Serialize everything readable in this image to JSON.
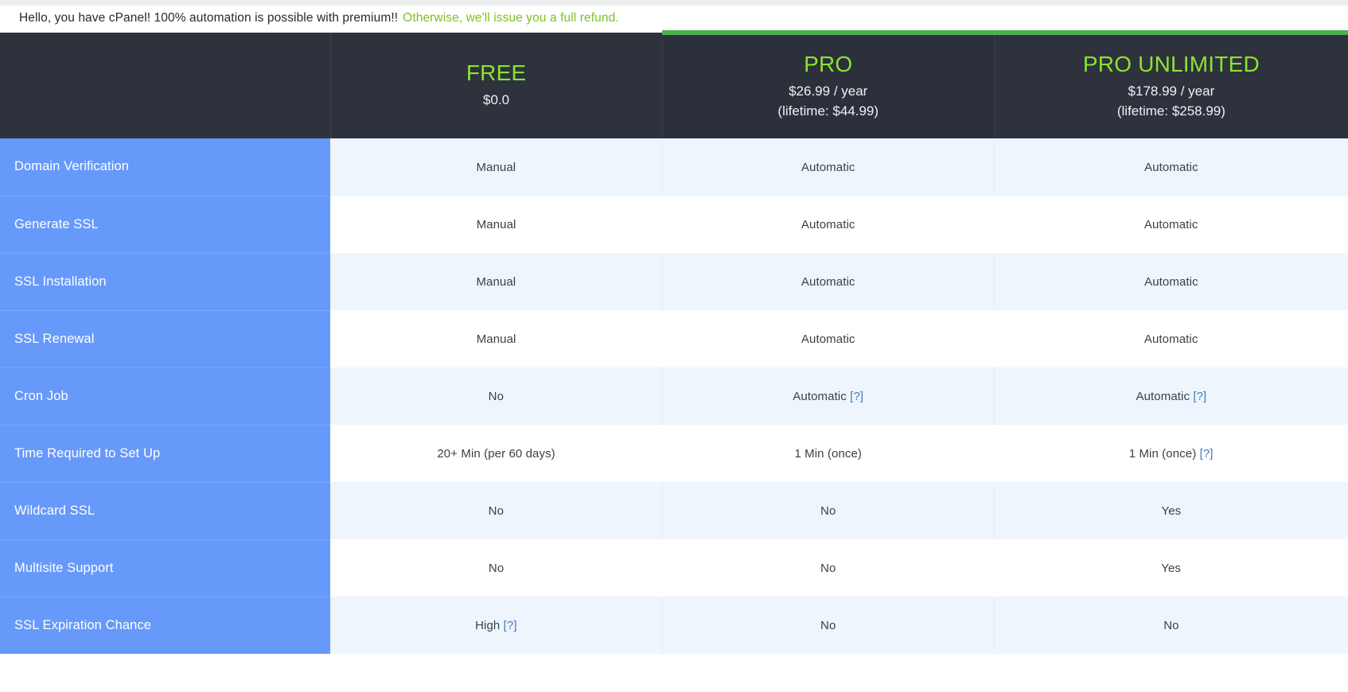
{
  "banner": {
    "message": "Hello, you have cPanel! 100% automation is possible with premium!!",
    "refund_link": "Otherwise, we'll issue you a full refund."
  },
  "table": {
    "feature_column_header": "",
    "plans": [
      {
        "name": "FREE",
        "price": "$0.0",
        "lifetime": "",
        "highlighted": false
      },
      {
        "name": "PRO",
        "price": "$26.99 / year",
        "lifetime": "(lifetime: $44.99)",
        "highlighted": true
      },
      {
        "name": "PRO UNLIMITED",
        "price": "$178.99 / year",
        "lifetime": "(lifetime: $258.99)",
        "highlighted": false
      }
    ],
    "rows": [
      {
        "feature": "Domain Verification",
        "free": "Manual",
        "free_hint": "",
        "pro": "Automatic",
        "pro_hint": "",
        "pro_unlimited": "Automatic",
        "pro_unlimited_hint": ""
      },
      {
        "feature": "Generate SSL",
        "free": "Manual",
        "free_hint": "",
        "pro": "Automatic",
        "pro_hint": "",
        "pro_unlimited": "Automatic",
        "pro_unlimited_hint": ""
      },
      {
        "feature": "SSL Installation",
        "free": "Manual",
        "free_hint": "",
        "pro": "Automatic",
        "pro_hint": "",
        "pro_unlimited": "Automatic",
        "pro_unlimited_hint": ""
      },
      {
        "feature": "SSL Renewal",
        "free": "Manual",
        "free_hint": "",
        "pro": "Automatic",
        "pro_hint": "",
        "pro_unlimited": "Automatic",
        "pro_unlimited_hint": ""
      },
      {
        "feature": "Cron Job",
        "free": "No",
        "free_hint": "",
        "pro": "Automatic ",
        "pro_hint": "[?]",
        "pro_unlimited": "Automatic ",
        "pro_unlimited_hint": "[?]"
      },
      {
        "feature": "Time Required to Set Up",
        "free": "20+ Min (per 60 days)",
        "free_hint": "",
        "pro": "1 Min (once)",
        "pro_hint": "",
        "pro_unlimited": "1 Min (once) ",
        "pro_unlimited_hint": "[?]"
      },
      {
        "feature": "Wildcard SSL",
        "free": "No",
        "free_hint": "",
        "pro": "No",
        "pro_hint": "",
        "pro_unlimited": "Yes",
        "pro_unlimited_hint": ""
      },
      {
        "feature": "Multisite Support",
        "free": "No",
        "free_hint": "",
        "pro": "No",
        "pro_hint": "",
        "pro_unlimited": "Yes",
        "pro_unlimited_hint": ""
      },
      {
        "feature": "SSL Expiration Chance",
        "free": "High ",
        "free_hint": "[?]",
        "pro": "No",
        "pro_hint": "",
        "pro_unlimited": "No",
        "pro_unlimited_hint": ""
      }
    ]
  },
  "colors": {
    "header_bg": "#2d323d",
    "accent_green": "#8ce32e",
    "highlight_border": "#4caf50",
    "feature_blue": "#6699fa",
    "row_alt": "#eef5fd",
    "banner_green": "#7cc320",
    "hint_link": "#3d7ebb"
  }
}
